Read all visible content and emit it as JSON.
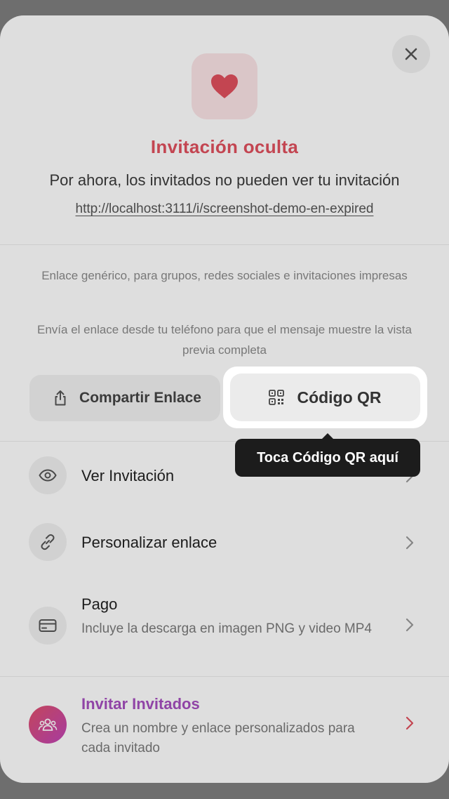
{
  "header": {
    "title": "Invitación oculta",
    "subtitle": "Por ahora, los invitados no pueden ver tu invitación",
    "url": "http://localhost:3111/i/screenshot-demo-en-expired"
  },
  "notes": {
    "line1": "Enlace genérico, para grupos, redes sociales e invitaciones impresas",
    "line2": "Envía el enlace desde tu teléfono para que el mensaje muestre la vista previa completa"
  },
  "actions": {
    "share_label": "Compartir Enlace",
    "qr_label": "Código QR"
  },
  "tooltip": {
    "text": "Toca Código QR aquí"
  },
  "menu": {
    "view": {
      "title": "Ver Invitación"
    },
    "customize": {
      "title": "Personalizar enlace"
    },
    "payment": {
      "title": "Pago",
      "desc": "Incluye la descarga en imagen PNG y video MP4"
    },
    "invite": {
      "title": "Invitar Invitados",
      "desc": "Crea un nombre y enlace personalizados para cada invitado"
    }
  },
  "icons": {
    "close": "close-icon",
    "heart": "heart-icon",
    "share": "share-icon",
    "qr": "qr-code-icon",
    "eye": "eye-icon",
    "link": "link-icon",
    "card": "credit-card-icon",
    "guests": "guests-icon",
    "chevron": "chevron-right-icon"
  },
  "colors": {
    "accent": "#e0505e",
    "invite_gradient_start": "#e0506a",
    "invite_gradient_end": "#c045b8",
    "tooltip_bg": "#1c1c1c"
  }
}
